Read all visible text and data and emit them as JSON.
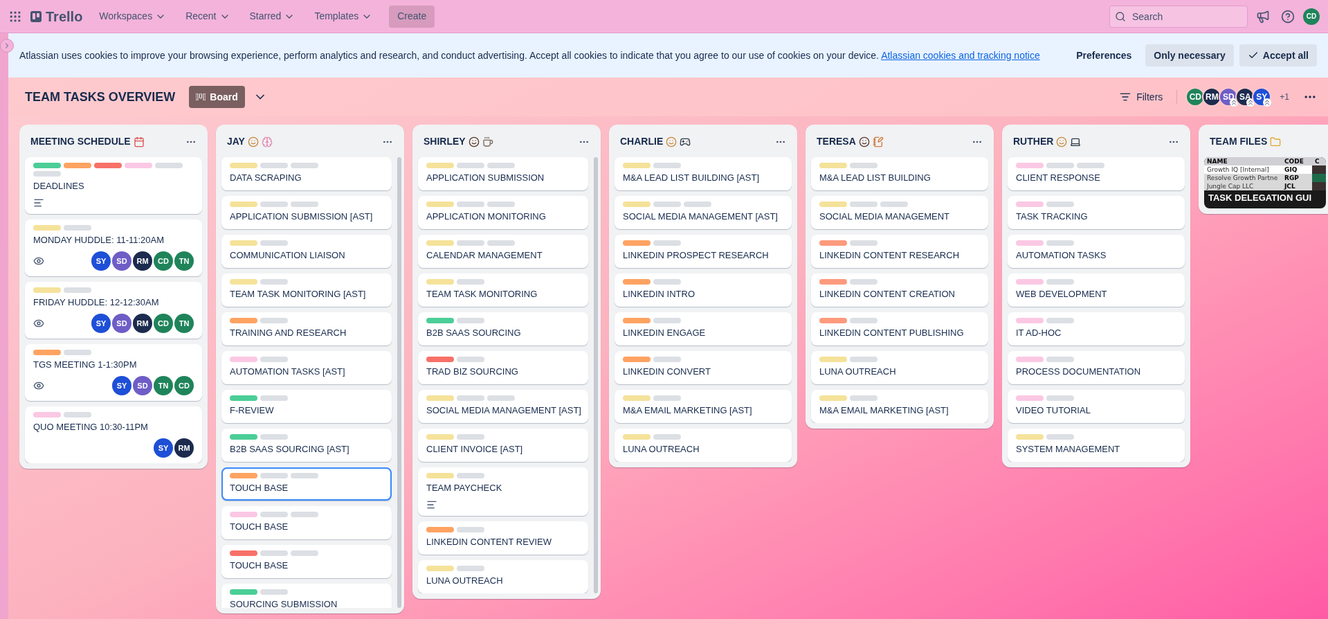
{
  "nav": {
    "logo": "Trello",
    "items": [
      {
        "label": "Workspaces"
      },
      {
        "label": "Recent"
      },
      {
        "label": "Starred"
      },
      {
        "label": "Templates"
      }
    ],
    "create": "Create",
    "search": {
      "placeholder": "Search"
    },
    "account": {
      "initials": "CD",
      "color": "#1f845a"
    }
  },
  "cookie_banner": {
    "text": "Atlassian uses cookies to improve your browsing experience, perform analytics and research, and conduct advertising. Accept all cookies to indicate that you agree to our use of cookies on your device.",
    "link": "Atlassian cookies and tracking notice",
    "buttons": [
      {
        "label": "Preferences",
        "kind": "text"
      },
      {
        "label": "Only necessary",
        "kind": "secondary"
      },
      {
        "label": "Accept all",
        "kind": "primary"
      }
    ]
  },
  "board": {
    "title": "TEAM TASKS OVERVIEW",
    "view": "Board",
    "filters": "Filters",
    "members": [
      {
        "initials": "CD",
        "color": "#1f845a",
        "admin": false
      },
      {
        "initials": "RM",
        "color": "#1c2b4e",
        "admin": false
      },
      {
        "initials": "SD",
        "color": "#6e5dc6",
        "admin": true
      },
      {
        "initials": "SA",
        "color": "#1c2b4e",
        "admin": true
      },
      {
        "initials": "SY",
        "color": "#1d4fd7",
        "admin": true
      }
    ],
    "extra_members": "+1"
  },
  "lists": [
    {
      "title": "MEETING SCHEDULE",
      "icons": [
        {
          "kind": "calendar"
        }
      ],
      "cards": [
        {
          "title": "DEADLINES",
          "selected": false,
          "labels": [
            {
              "color": "#4bce97"
            },
            {
              "color": "#fea362"
            },
            {
              "color": "#f87168"
            },
            {
              "color": "#fbc8e4"
            },
            {
              "color": "#dcdfe4"
            },
            {
              "color": "#dcdfe4"
            }
          ],
          "badges": [
            {
              "kind": "description"
            }
          ]
        },
        {
          "title": "MONDAY HUDDLE: 11-11:20AM",
          "selected": false,
          "labels": [
            {
              "color": "#f5e29a"
            },
            {
              "color": "#dcdfe4"
            }
          ],
          "badges": [
            {
              "kind": "watch"
            }
          ],
          "members": [
            {
              "initials": "SY",
              "color": "#1d4fd7"
            },
            {
              "initials": "SD",
              "color": "#6e5dc6"
            },
            {
              "initials": "RM",
              "color": "#1c2b4e"
            },
            {
              "initials": "CD",
              "color": "#1f845a"
            },
            {
              "initials": "TN",
              "color": "#1f845a"
            }
          ]
        },
        {
          "title": "FRIDAY HUDDLE: 12-12:30AM",
          "selected": false,
          "labels": [
            {
              "color": "#f5e29a"
            },
            {
              "color": "#dcdfe4"
            }
          ],
          "badges": [
            {
              "kind": "watch"
            }
          ],
          "members": [
            {
              "initials": "SY",
              "color": "#1d4fd7"
            },
            {
              "initials": "SD",
              "color": "#6e5dc6"
            },
            {
              "initials": "RM",
              "color": "#1c2b4e"
            },
            {
              "initials": "CD",
              "color": "#1f845a"
            },
            {
              "initials": "TN",
              "color": "#1f845a"
            }
          ]
        },
        {
          "title": "TGS MEETING 1-1:30PM",
          "selected": false,
          "labels": [
            {
              "color": "#fea362"
            },
            {
              "color": "#dcdfe4"
            }
          ],
          "badges": [
            {
              "kind": "watch"
            }
          ],
          "members": [
            {
              "initials": "SY",
              "color": "#1d4fd7"
            },
            {
              "initials": "SD",
              "color": "#6e5dc6"
            },
            {
              "initials": "TN",
              "color": "#1f845a"
            },
            {
              "initials": "CD",
              "color": "#1f845a"
            }
          ]
        },
        {
          "title": "QUO MEETING 10:30-11PM",
          "selected": false,
          "labels": [
            {
              "color": "#fbc8e4"
            },
            {
              "color": "#dcdfe4"
            }
          ],
          "members": [
            {
              "initials": "SY",
              "color": "#1d4fd7"
            },
            {
              "initials": "RM",
              "color": "#1c2b4e"
            }
          ]
        }
      ]
    },
    {
      "title": "JAY",
      "icons": [
        {
          "kind": "face"
        },
        {
          "kind": "brain"
        }
      ],
      "cards": [
        {
          "title": "DATA SCRAPING",
          "selected": false,
          "labels": [
            {
              "color": "#f5e29a"
            },
            {
              "color": "#dcdfe4"
            },
            {
              "color": "#dcdfe4"
            }
          ]
        },
        {
          "title": "APPLICATION SUBMISSION [AST]",
          "selected": false,
          "labels": [
            {
              "color": "#f5e29a"
            },
            {
              "color": "#dcdfe4"
            },
            {
              "color": "#dcdfe4"
            }
          ]
        },
        {
          "title": "COMMUNICATION LIAISON",
          "selected": false,
          "labels": [
            {
              "color": "#f5e29a"
            },
            {
              "color": "#dcdfe4"
            }
          ]
        },
        {
          "title": "TEAM TASK MONITORING [AST]",
          "selected": false,
          "labels": [
            {
              "color": "#f5e29a"
            },
            {
              "color": "#dcdfe4"
            }
          ]
        },
        {
          "title": "TRAINING AND RESEARCH",
          "selected": false,
          "labels": [
            {
              "color": "#fea362"
            },
            {
              "color": "#dcdfe4"
            }
          ]
        },
        {
          "title": "AUTOMATION TASKS [AST]",
          "selected": false,
          "labels": [
            {
              "color": "#fbc8e4"
            },
            {
              "color": "#dcdfe4"
            }
          ]
        },
        {
          "title": "F-REVIEW",
          "selected": false,
          "labels": [
            {
              "color": "#4bce97"
            },
            {
              "color": "#dcdfe4"
            }
          ]
        },
        {
          "title": "B2B SAAS SOURCING [AST]",
          "selected": false,
          "labels": [
            {
              "color": "#4bce97"
            },
            {
              "color": "#dcdfe4"
            }
          ]
        },
        {
          "title": "TOUCH BASE",
          "selected": true,
          "labels": [
            {
              "color": "#fea362"
            },
            {
              "color": "#dcdfe4"
            },
            {
              "color": "#dcdfe4"
            }
          ]
        },
        {
          "title": "TOUCH BASE",
          "selected": false,
          "labels": [
            {
              "color": "#fbc8e4"
            },
            {
              "color": "#dcdfe4"
            },
            {
              "color": "#dcdfe4"
            }
          ]
        },
        {
          "title": "TOUCH BASE",
          "selected": false,
          "labels": [
            {
              "color": "#f87168"
            },
            {
              "color": "#dcdfe4"
            },
            {
              "color": "#dcdfe4"
            }
          ]
        },
        {
          "title": "SOURCING SUBMISSION",
          "selected": false,
          "labels": [
            {
              "color": "#4bce97"
            },
            {
              "color": "#dcdfe4"
            }
          ]
        }
      ]
    },
    {
      "title": "SHIRLEY",
      "icons": [
        {
          "kind": "woman"
        },
        {
          "kind": "cup"
        }
      ],
      "cards": [
        {
          "title": "APPLICATION SUBMISSION",
          "selected": false,
          "labels": [
            {
              "color": "#f5e29a"
            },
            {
              "color": "#dcdfe4"
            },
            {
              "color": "#dcdfe4"
            }
          ]
        },
        {
          "title": "APPLICATION MONITORING",
          "selected": false,
          "labels": [
            {
              "color": "#f5e29a"
            },
            {
              "color": "#dcdfe4"
            },
            {
              "color": "#dcdfe4"
            }
          ]
        },
        {
          "title": "CALENDAR MANAGEMENT",
          "selected": false,
          "labels": [
            {
              "color": "#f5e29a"
            },
            {
              "color": "#dcdfe4"
            },
            {
              "color": "#dcdfe4"
            }
          ]
        },
        {
          "title": "TEAM TASK MONITORING",
          "selected": false,
          "labels": [
            {
              "color": "#f5e29a"
            },
            {
              "color": "#dcdfe4"
            }
          ]
        },
        {
          "title": "B2B SAAS SOURCING",
          "selected": false,
          "labels": [
            {
              "color": "#4bce97"
            },
            {
              "color": "#dcdfe4"
            }
          ]
        },
        {
          "title": "TRAD BIZ SOURCING",
          "selected": false,
          "labels": [
            {
              "color": "#f87168"
            },
            {
              "color": "#dcdfe4"
            }
          ]
        },
        {
          "title": "SOCIAL MEDIA MANAGEMENT [AST]",
          "selected": false,
          "labels": [
            {
              "color": "#f5e29a"
            },
            {
              "color": "#dcdfe4"
            },
            {
              "color": "#dcdfe4"
            }
          ]
        },
        {
          "title": "CLIENT INVOICE [AST]",
          "selected": false,
          "labels": [
            {
              "color": "#f5e29a"
            },
            {
              "color": "#dcdfe4"
            }
          ]
        },
        {
          "title": "TEAM PAYCHECK",
          "selected": false,
          "labels": [
            {
              "color": "#f5e29a"
            },
            {
              "color": "#dcdfe4"
            }
          ],
          "badges": [
            {
              "kind": "description"
            }
          ]
        },
        {
          "title": "LINKEDIN CONTENT REVIEW",
          "selected": false,
          "labels": [
            {
              "color": "#fea362"
            },
            {
              "color": "#dcdfe4"
            }
          ]
        },
        {
          "title": "LUNA OUTREACH",
          "selected": false,
          "labels": [
            {
              "color": "#f5e29a"
            },
            {
              "color": "#dcdfe4"
            }
          ]
        }
      ]
    },
    {
      "title": "CHARLIE",
      "icons": [
        {
          "kind": "face"
        },
        {
          "kind": "gamepad"
        }
      ],
      "cards": [
        {
          "title": "M&A LEAD LIST BUILDING [AST]",
          "selected": false,
          "labels": [
            {
              "color": "#f5e29a"
            },
            {
              "color": "#dcdfe4"
            }
          ]
        },
        {
          "title": "SOCIAL MEDIA MANAGEMENT [AST]",
          "selected": false,
          "labels": [
            {
              "color": "#f5e29a"
            },
            {
              "color": "#dcdfe4"
            },
            {
              "color": "#dcdfe4"
            }
          ]
        },
        {
          "title": "LINKEDIN PROSPECT RESEARCH",
          "selected": false,
          "labels": [
            {
              "color": "#fea362"
            },
            {
              "color": "#dcdfe4"
            }
          ]
        },
        {
          "title": "LINKEDIN INTRO",
          "selected": false,
          "labels": [
            {
              "color": "#fea362"
            },
            {
              "color": "#dcdfe4"
            }
          ]
        },
        {
          "title": "LINKEDIN ENGAGE",
          "selected": false,
          "labels": [
            {
              "color": "#fea362"
            },
            {
              "color": "#dcdfe4"
            }
          ]
        },
        {
          "title": "LINKEDIN CONVERT",
          "selected": false,
          "labels": [
            {
              "color": "#fea362"
            },
            {
              "color": "#dcdfe4"
            }
          ]
        },
        {
          "title": "M&A EMAIL MARKETING [AST]",
          "selected": false,
          "labels": [
            {
              "color": "#f5e29a"
            },
            {
              "color": "#dcdfe4"
            }
          ]
        },
        {
          "title": "LUNA OUTREACH",
          "selected": false,
          "labels": [
            {
              "color": "#f5e29a"
            },
            {
              "color": "#dcdfe4"
            }
          ]
        }
      ]
    },
    {
      "title": "TERESA",
      "icons": [
        {
          "kind": "woman"
        },
        {
          "kind": "memo"
        }
      ],
      "cards": [
        {
          "title": "M&A LEAD LIST BUILDING",
          "selected": false,
          "labels": [
            {
              "color": "#f5e29a"
            },
            {
              "color": "#dcdfe4"
            }
          ]
        },
        {
          "title": "SOCIAL MEDIA MANAGEMENT",
          "selected": false,
          "labels": [
            {
              "color": "#f5e29a"
            },
            {
              "color": "#dcdfe4"
            },
            {
              "color": "#dcdfe4"
            }
          ]
        },
        {
          "title": "LINKEDIN CONTENT RESEARCH",
          "selected": false,
          "labels": [
            {
              "color": "#fd9a7d"
            },
            {
              "color": "#dcdfe4"
            }
          ]
        },
        {
          "title": "LINKEDIN CONTENT CREATION",
          "selected": false,
          "labels": [
            {
              "color": "#fd9a7d"
            },
            {
              "color": "#dcdfe4"
            }
          ]
        },
        {
          "title": "LINKEDIN CONTENT PUBLISHING",
          "selected": false,
          "labels": [
            {
              "color": "#fd9a7d"
            },
            {
              "color": "#dcdfe4"
            }
          ]
        },
        {
          "title": "LUNA OUTREACH",
          "selected": false,
          "labels": [
            {
              "color": "#f5e29a"
            },
            {
              "color": "#dcdfe4"
            }
          ]
        },
        {
          "title": "M&A EMAIL MARKETING [AST]",
          "selected": false,
          "labels": [
            {
              "color": "#f5e29a"
            },
            {
              "color": "#dcdfe4"
            }
          ]
        }
      ]
    },
    {
      "title": "RUTHER",
      "icons": [
        {
          "kind": "face"
        },
        {
          "kind": "laptop"
        }
      ],
      "cards": [
        {
          "title": "CLIENT RESPONSE",
          "selected": false,
          "labels": [
            {
              "color": "#fbc8e4"
            },
            {
              "color": "#dcdfe4"
            },
            {
              "color": "#dcdfe4"
            }
          ]
        },
        {
          "title": "TASK TRACKING",
          "selected": false,
          "labels": [
            {
              "color": "#fbc8e4"
            },
            {
              "color": "#dcdfe4"
            }
          ]
        },
        {
          "title": "AUTOMATION TASKS",
          "selected": false,
          "labels": [
            {
              "color": "#fbc8e4"
            },
            {
              "color": "#dcdfe4"
            }
          ]
        },
        {
          "title": "WEB DEVELOPMENT",
          "selected": false,
          "labels": [
            {
              "color": "#fbc8e4"
            },
            {
              "color": "#dcdfe4"
            }
          ]
        },
        {
          "title": "IT AD-HOC",
          "selected": false,
          "labels": [
            {
              "color": "#fbc8e4"
            },
            {
              "color": "#dcdfe4"
            }
          ]
        },
        {
          "title": "PROCESS DOCUMENTATION",
          "selected": false,
          "labels": [
            {
              "color": "#fbc8e4"
            },
            {
              "color": "#dcdfe4"
            }
          ]
        },
        {
          "title": "VIDEO TUTORIAL",
          "selected": false,
          "labels": [
            {
              "color": "#fbc8e4"
            },
            {
              "color": "#dcdfe4"
            }
          ]
        },
        {
          "title": "SYSTEM MANAGEMENT",
          "selected": false,
          "labels": [
            {
              "color": "#f5e29a"
            },
            {
              "color": "#dcdfe4"
            }
          ]
        }
      ]
    },
    {
      "title": "TEAM FILES",
      "icons": [
        {
          "kind": "folder"
        }
      ],
      "cover_card": {
        "columns": [
          "NAME",
          "CODE",
          "C"
        ],
        "rows": [
          [
            "Growth IQ [Internal]",
            "GIQ"
          ],
          [
            "Resolve Growth Partne",
            "RGP"
          ],
          [
            "Jungle Cap LLC",
            "JCL"
          ]
        ],
        "caption": "TASK DELEGATION GUI"
      }
    }
  ]
}
